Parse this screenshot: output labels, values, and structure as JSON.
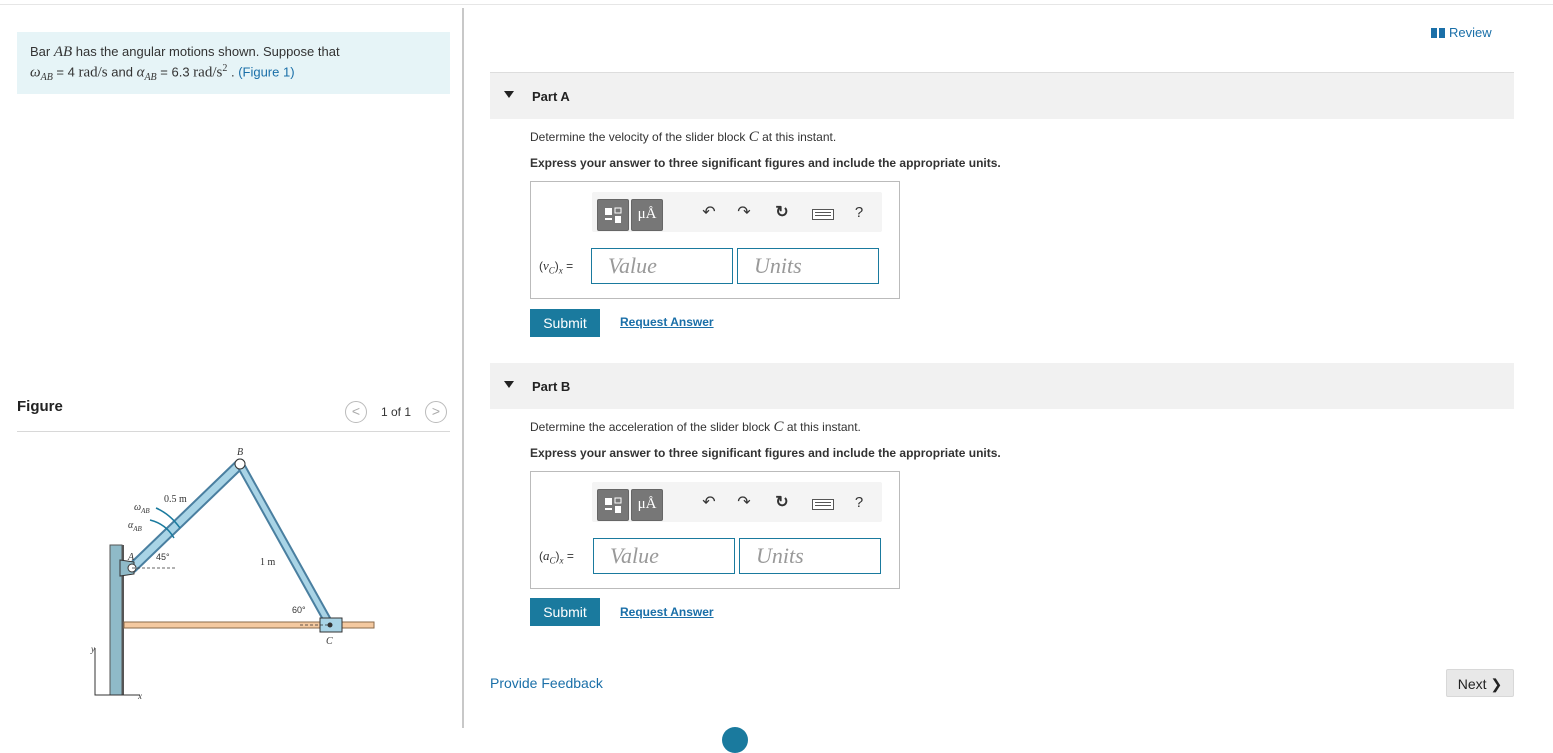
{
  "problem": {
    "pre": "Bar ",
    "bar_name": "AB",
    "mid": " has the angular motions shown. Suppose that",
    "omega_sym": "ω",
    "omega_sub": "AB",
    "omega_eq": " = 4 ",
    "omega_unit": "rad/s",
    "and": " and ",
    "alpha_sym": "α",
    "alpha_sub": "AB",
    "alpha_eq": " = 6.3 ",
    "alpha_unit": "rad/s",
    "alpha_unit_exp": "2",
    "dot": " . ",
    "figure_link": "(Figure 1)"
  },
  "figure": {
    "header": "Figure",
    "prev": "<",
    "next": ">",
    "pager": "1 of 1",
    "labels": {
      "B": "B",
      "A": "A",
      "C": "C",
      "len_ab": "0.5 m",
      "len_bc": "1 m",
      "angle_a": "45°",
      "angle_c": "60°",
      "omega": "ω",
      "omega_sub": "AB",
      "alpha": "α",
      "alpha_sub": "AB",
      "axis_x": "x",
      "axis_y": "y"
    }
  },
  "review_label": "Review",
  "parts": [
    {
      "title": "Part A",
      "prompt_pre": "Determine the velocity of the slider block ",
      "prompt_var": "C",
      "prompt_post": " at this instant.",
      "instruction": "Express your answer to three significant figures and include the appropriate units.",
      "lhs_sym": "v",
      "lhs_sub": "C",
      "lhs_post": "x",
      "lhs_eq": " =",
      "value_placeholder": "Value",
      "units_placeholder": "Units",
      "submit": "Submit",
      "request": "Request Answer"
    },
    {
      "title": "Part B",
      "prompt_pre": "Determine the acceleration of the slider block ",
      "prompt_var": "C",
      "prompt_post": " at this instant.",
      "instruction": "Express your answer to three significant figures and include the appropriate units.",
      "lhs_sym": "a",
      "lhs_sub": "C",
      "lhs_post": "x",
      "lhs_eq": " =",
      "value_placeholder": "Value",
      "units_placeholder": "Units",
      "submit": "Submit",
      "request": "Request Answer"
    }
  ],
  "toolbar": {
    "units_glyph": "μÅ",
    "undo_glyph": "↶",
    "redo_glyph": "↷",
    "reset_glyph": "↻",
    "help_glyph": "?"
  },
  "feedback_label": "Provide Feedback",
  "next_label": "Next",
  "next_glyph": "❯",
  "colors": {
    "accent": "#1a7a9e",
    "link": "#1a6fa8",
    "problem_bg": "#e6f4f7",
    "part_header_bg": "#f1f1f1"
  },
  "icons": [
    "book-icon",
    "caret-down-icon",
    "templates-icon",
    "units-icon",
    "undo-icon",
    "redo-icon",
    "reset-icon",
    "keyboard-icon",
    "help-icon",
    "chevron-left-icon",
    "chevron-right-icon"
  ]
}
